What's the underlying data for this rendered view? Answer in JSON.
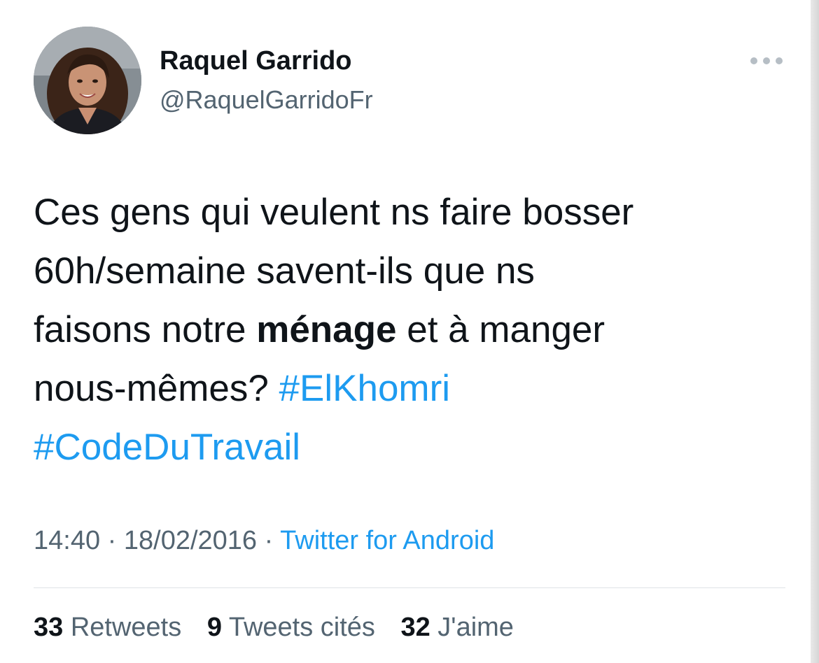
{
  "tweet": {
    "author": {
      "display_name": "Raquel Garrido",
      "handle": "@RaquelGarridoFr"
    },
    "text": {
      "line1": "Ces gens qui veulent ns faire bosser",
      "line2": "60h/semaine savent-ils que ns",
      "line3_pre": "faisons notre ",
      "line3_bold": "ménage",
      "line3_post": " et à manger",
      "line4": "nous-mêmes? ",
      "hashtag1": "#ElKhomri",
      "hashtag2": "#CodeDuTravail"
    },
    "time": "14:40",
    "date": "18/02/2016",
    "separator": " · ",
    "source": "Twitter for Android",
    "stats": {
      "retweets_count": "33",
      "retweets_label": " Retweets",
      "quotes_count": "9",
      "quotes_label": " Tweets cités",
      "likes_count": "32",
      "likes_label": " J'aime"
    }
  },
  "icons": {
    "more": "more-horizontal-icon",
    "avatar": "profile-photo"
  },
  "colors": {
    "link": "#1d9bf0",
    "primary_text": "#0f1419",
    "secondary_text": "#536471",
    "divider": "#dfe3e6"
  }
}
